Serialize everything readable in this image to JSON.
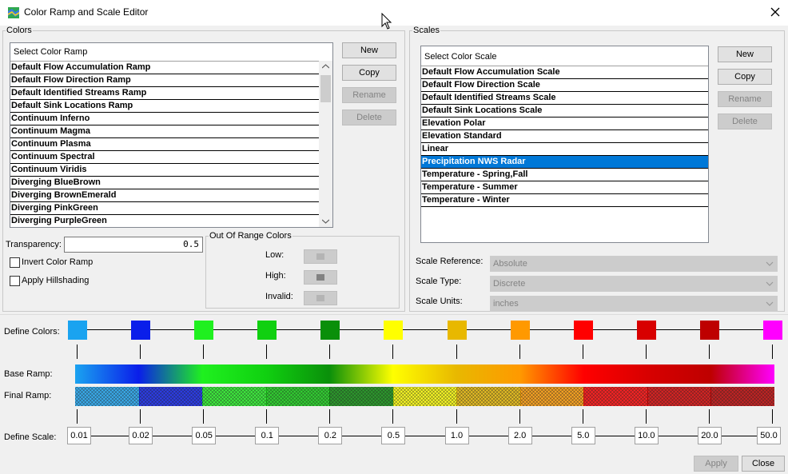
{
  "window": {
    "title": "Color Ramp and Scale Editor"
  },
  "colors_panel": {
    "legend": "Colors",
    "list_header": "Select Color Ramp",
    "ramps": [
      "Default Flow Accumulation Ramp",
      "Default Flow Direction Ramp",
      "Default Identified Streams Ramp",
      "Default Sink Locations Ramp",
      "Continuum Inferno",
      "Continuum Magma",
      "Continuum Plasma",
      "Continuum Spectral",
      "Continuum Viridis",
      "Diverging BlueBrown",
      "Diverging BrownEmerald",
      "Diverging PinkGreen",
      "Diverging PurpleGreen"
    ],
    "buttons": {
      "new": "New",
      "copy": "Copy",
      "rename": "Rename",
      "delete": "Delete"
    },
    "transparency_label": "Transparency:",
    "transparency_value": "0.5",
    "invert_label": "Invert Color Ramp",
    "hillshade_label": "Apply Hillshading",
    "out_of_range": {
      "legend": "Out Of Range Colors",
      "low_label": "Low:",
      "high_label": "High:",
      "invalid_label": "Invalid:",
      "low_color": "#b4b4b4",
      "high_color": "#828282",
      "invalid_color": "#b4b4b4"
    }
  },
  "scales_panel": {
    "legend": "Scales",
    "list_header": "Select Color Scale",
    "scales": [
      "Default Flow Accumulation Scale",
      "Default Flow Direction Scale",
      "Default Identified Streams Scale",
      "Default Sink Locations Scale",
      "Elevation Polar",
      "Elevation Standard",
      "Linear",
      "Precipitation NWS Radar",
      "Temperature - Spring,Fall",
      "Temperature - Summer",
      "Temperature - Winter"
    ],
    "selected_index": 7,
    "buttons": {
      "new": "New",
      "copy": "Copy",
      "rename": "Rename",
      "delete": "Delete"
    },
    "scale_reference_label": "Scale Reference:",
    "scale_reference_value": "Absolute",
    "scale_type_label": "Scale Type:",
    "scale_type_value": "Discrete",
    "scale_units_label": "Scale Units:",
    "scale_units_value": "inches"
  },
  "define": {
    "colors_label": "Define Colors:",
    "base_ramp_label": "Base Ramp:",
    "final_ramp_label": "Final Ramp:",
    "scale_label": "Define Scale:",
    "colors": [
      "#1aa3f0",
      "#0a1eea",
      "#1ff01f",
      "#10d010",
      "#0a8f0a",
      "#ffff00",
      "#e8b800",
      "#ff9900",
      "#ff0000",
      "#d80000",
      "#be0000",
      "#ff00ff"
    ],
    "scale_values": [
      "0.01",
      "0.02",
      "0.05",
      "0.1",
      "0.2",
      "0.5",
      "1.0",
      "2.0",
      "5.0",
      "10.0",
      "20.0",
      "50.0"
    ]
  },
  "footer": {
    "apply": "Apply",
    "close": "Close"
  }
}
